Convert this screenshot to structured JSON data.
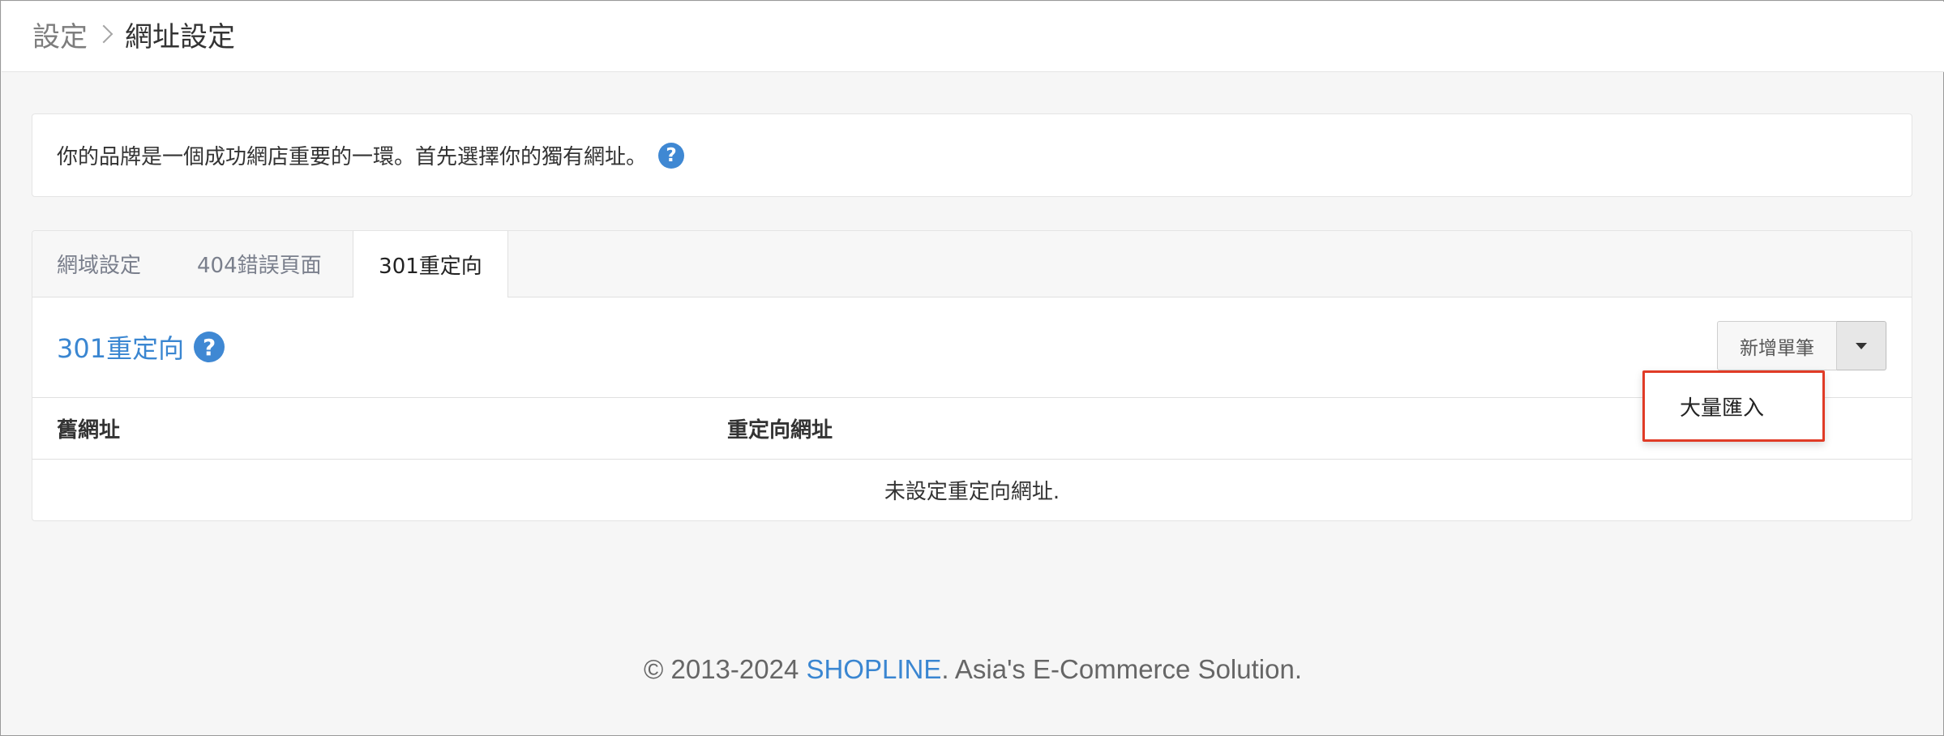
{
  "breadcrumb": {
    "parent": "設定",
    "current": "網址設定"
  },
  "intro": {
    "text": "你的品牌是一個成功網店重要的一環。首先選擇你的獨有網址。"
  },
  "icons": {
    "help": "?",
    "help_name": "question-circle-icon",
    "caret_name": "caret-down-icon"
  },
  "tabs": [
    {
      "label": "網域設定",
      "active": false
    },
    {
      "label": "404錯誤頁面",
      "active": false
    },
    {
      "label": "301重定向",
      "active": true
    }
  ],
  "section": {
    "title": "301重定向"
  },
  "actions": {
    "add_label": "新增單筆",
    "dropdown_items": [
      "大量匯入"
    ]
  },
  "table": {
    "columns": [
      "舊網址",
      "重定向網址"
    ],
    "empty_text": "未設定重定向網址."
  },
  "footer": {
    "prefix": "© 2013-2024 ",
    "brand": "SHOPLINE",
    "suffix": ". Asia's E-Commerce Solution."
  },
  "colors": {
    "accent": "#3a86d1",
    "highlight": "#e03b26",
    "background": "#f6f6f6"
  }
}
